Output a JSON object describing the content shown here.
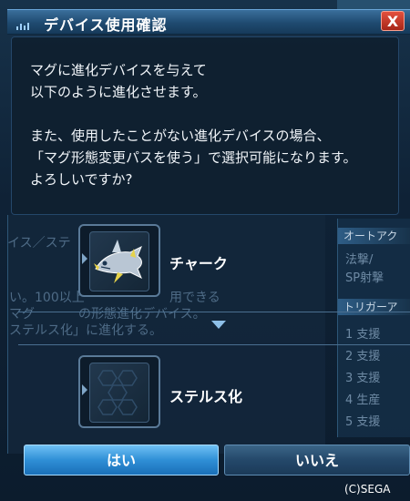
{
  "dialog": {
    "title": "デバイス使用確認",
    "close_label": "X",
    "message": {
      "line1": "マグに進化デバイスを与えて",
      "line2": "以下のように進化させます。",
      "line3": "また、使用したことがない進化デバイスの場合、",
      "line4": "「マグ形態変更パスを使う」で選択可能になります。",
      "line5": "よろしいですか?"
    },
    "from_item": {
      "name": "チャーク",
      "icon": "shark-mag-icon"
    },
    "to_item": {
      "name": "ステルス化",
      "icon": "hex-grid-icon"
    },
    "buttons": {
      "yes": "はい",
      "no": "いいえ"
    }
  },
  "background": {
    "right_section_1": "オートアク",
    "right_lines_1": [
      "法撃/",
      "SP射撃"
    ],
    "right_section_2": "トリガーア",
    "right_lines_2": [
      "1 支援",
      "2 支援",
      "3 支援",
      "4 生産",
      "5 支援"
    ],
    "left_frags": [
      "イス／ステ",
      "い。100以上",
      "マグ",
      "ステルス化」に進化する。"
    ],
    "mid_text": "用できる",
    "mid_text2": "の形態進化デバイス。"
  },
  "copyright": "(C)SEGA",
  "colors": {
    "accent": "#2f8fd6",
    "panel": "#102030",
    "close": "#c23a28"
  }
}
